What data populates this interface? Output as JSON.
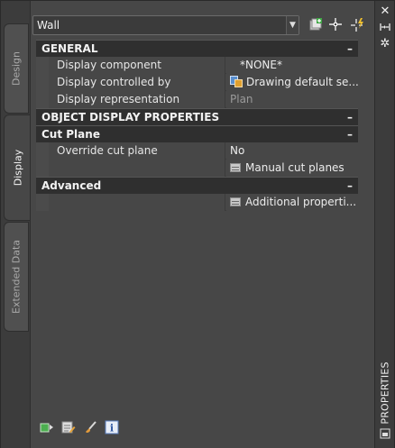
{
  "panel_title": "PROPERTIES",
  "tabs": [
    {
      "label": "Design",
      "active": false
    },
    {
      "label": "Display",
      "active": true
    },
    {
      "label": "Extended Data",
      "active": false
    }
  ],
  "selector": {
    "value": "Wall"
  },
  "toolbar_icons": [
    "add-style-icon",
    "crosshair-select-icon",
    "quick-select-icon"
  ],
  "title_strip_icons": [
    "close-icon",
    "auto-hide-icon",
    "settings-icon",
    "panel-menu-icon"
  ],
  "sections": {
    "general": {
      "title": "GENERAL",
      "collapse": "–",
      "rows": [
        {
          "name": "Display component",
          "value": "*NONE*"
        },
        {
          "name": "Display controlled by",
          "value": "Drawing default se..."
        },
        {
          "name": "Display representation",
          "value": "Plan"
        }
      ]
    },
    "object_display": {
      "title": "OBJECT DISPLAY PROPERTIES",
      "collapse": "–"
    },
    "cut_plane": {
      "title": "Cut Plane",
      "collapse": "–",
      "rows": [
        {
          "name": "Override cut plane",
          "value": "No"
        },
        {
          "name": "",
          "value": "Manual cut planes"
        }
      ]
    },
    "advanced": {
      "title": "Advanced",
      "collapse": "–",
      "rows": [
        {
          "name": "",
          "value": "Additional  properti..."
        }
      ]
    }
  },
  "bottom_icons": [
    "add-to-selection-icon",
    "edit-properties-icon",
    "match-properties-icon",
    "info-icon"
  ],
  "colors": {
    "panel_bg": "#474747",
    "category_bg": "#2f2f2f",
    "text": "#e8e8e8"
  }
}
